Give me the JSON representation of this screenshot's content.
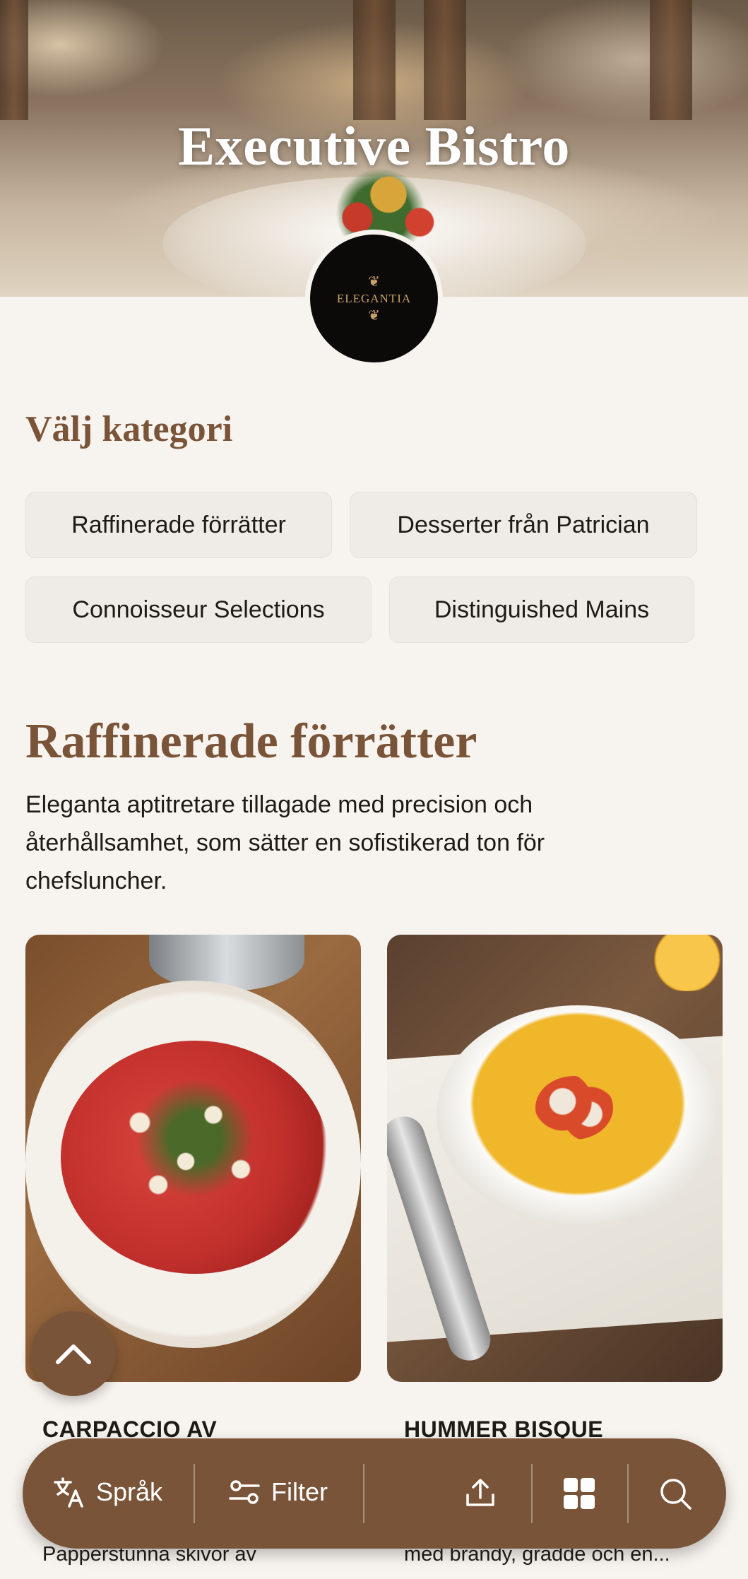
{
  "hero": {
    "title": "Executive Bistro",
    "logo_text": "ELEGANTIA"
  },
  "categories": {
    "heading": "Välj kategori",
    "items": [
      {
        "label": "Raffinerade förrätter"
      },
      {
        "label": "Desserter från Patrician"
      },
      {
        "label": "Connoisseur Selections"
      },
      {
        "label": "Distinguished Mains"
      }
    ]
  },
  "section": {
    "title": "Raffinerade förrätter",
    "description": "Eleganta aptitretare tillagade med precision och återhållsamhet, som sätter en sofistikerad ton för chefsluncher."
  },
  "cards": [
    {
      "name": "CARPACCIO AV",
      "description": "Papperstunna skivor av"
    },
    {
      "name": "HUMMER BISQUE",
      "description": "med brandy, grädde och en..."
    }
  ],
  "bottom_bar": {
    "language_label": "Språk",
    "filter_label": "Filter",
    "icons": [
      "translate-icon",
      "filter-icon",
      "share-icon",
      "grid-icon",
      "search-icon"
    ]
  },
  "colors": {
    "accent": "#7a5438",
    "background": "#f7f3ee",
    "chip": "#efebe6"
  }
}
